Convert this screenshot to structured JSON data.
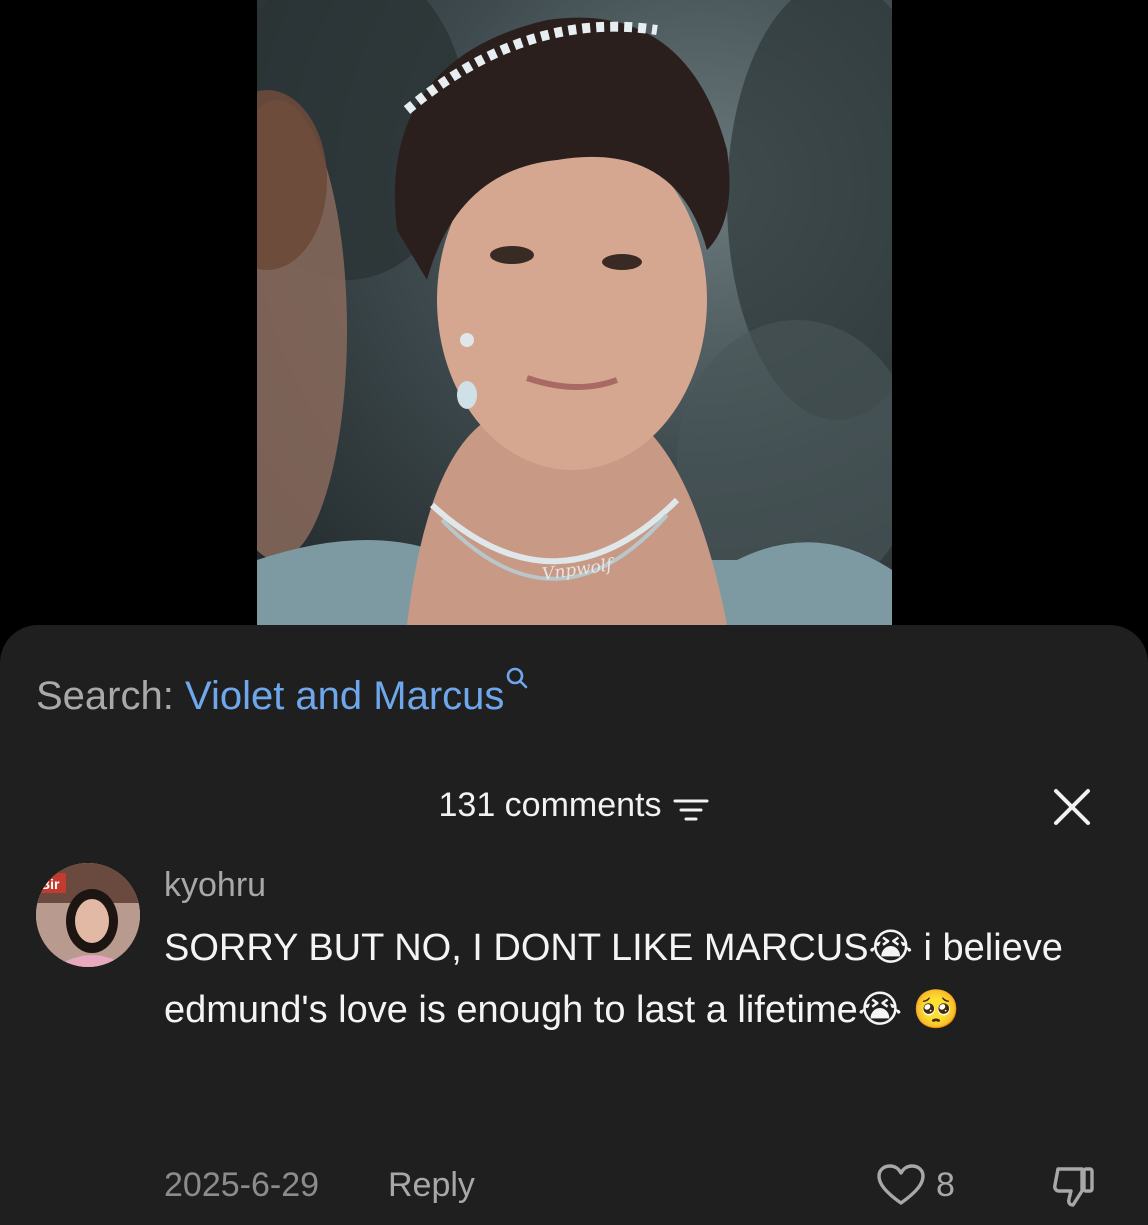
{
  "video": {
    "watermark": "Vnpwolf"
  },
  "search": {
    "prefix": "Search:",
    "term": "Violet and Marcus",
    "icon": "search-icon"
  },
  "comments_header": {
    "count_label": "131 comments",
    "filter_icon": "filter-icon",
    "close_icon": "close-icon"
  },
  "comment": {
    "username": "kyohru",
    "text": "SORRY BUT NO, I DONT LIKE MARCUS😭 i believe edmund's love is enough to last a lifetime😭 🥺",
    "date": "2025-6-29",
    "reply_label": "Reply",
    "like_count": "8"
  },
  "colors": {
    "sheet_bg": "#1f1f1f",
    "accent_link": "#6ea7ec",
    "muted_text": "#a8a8a8"
  }
}
